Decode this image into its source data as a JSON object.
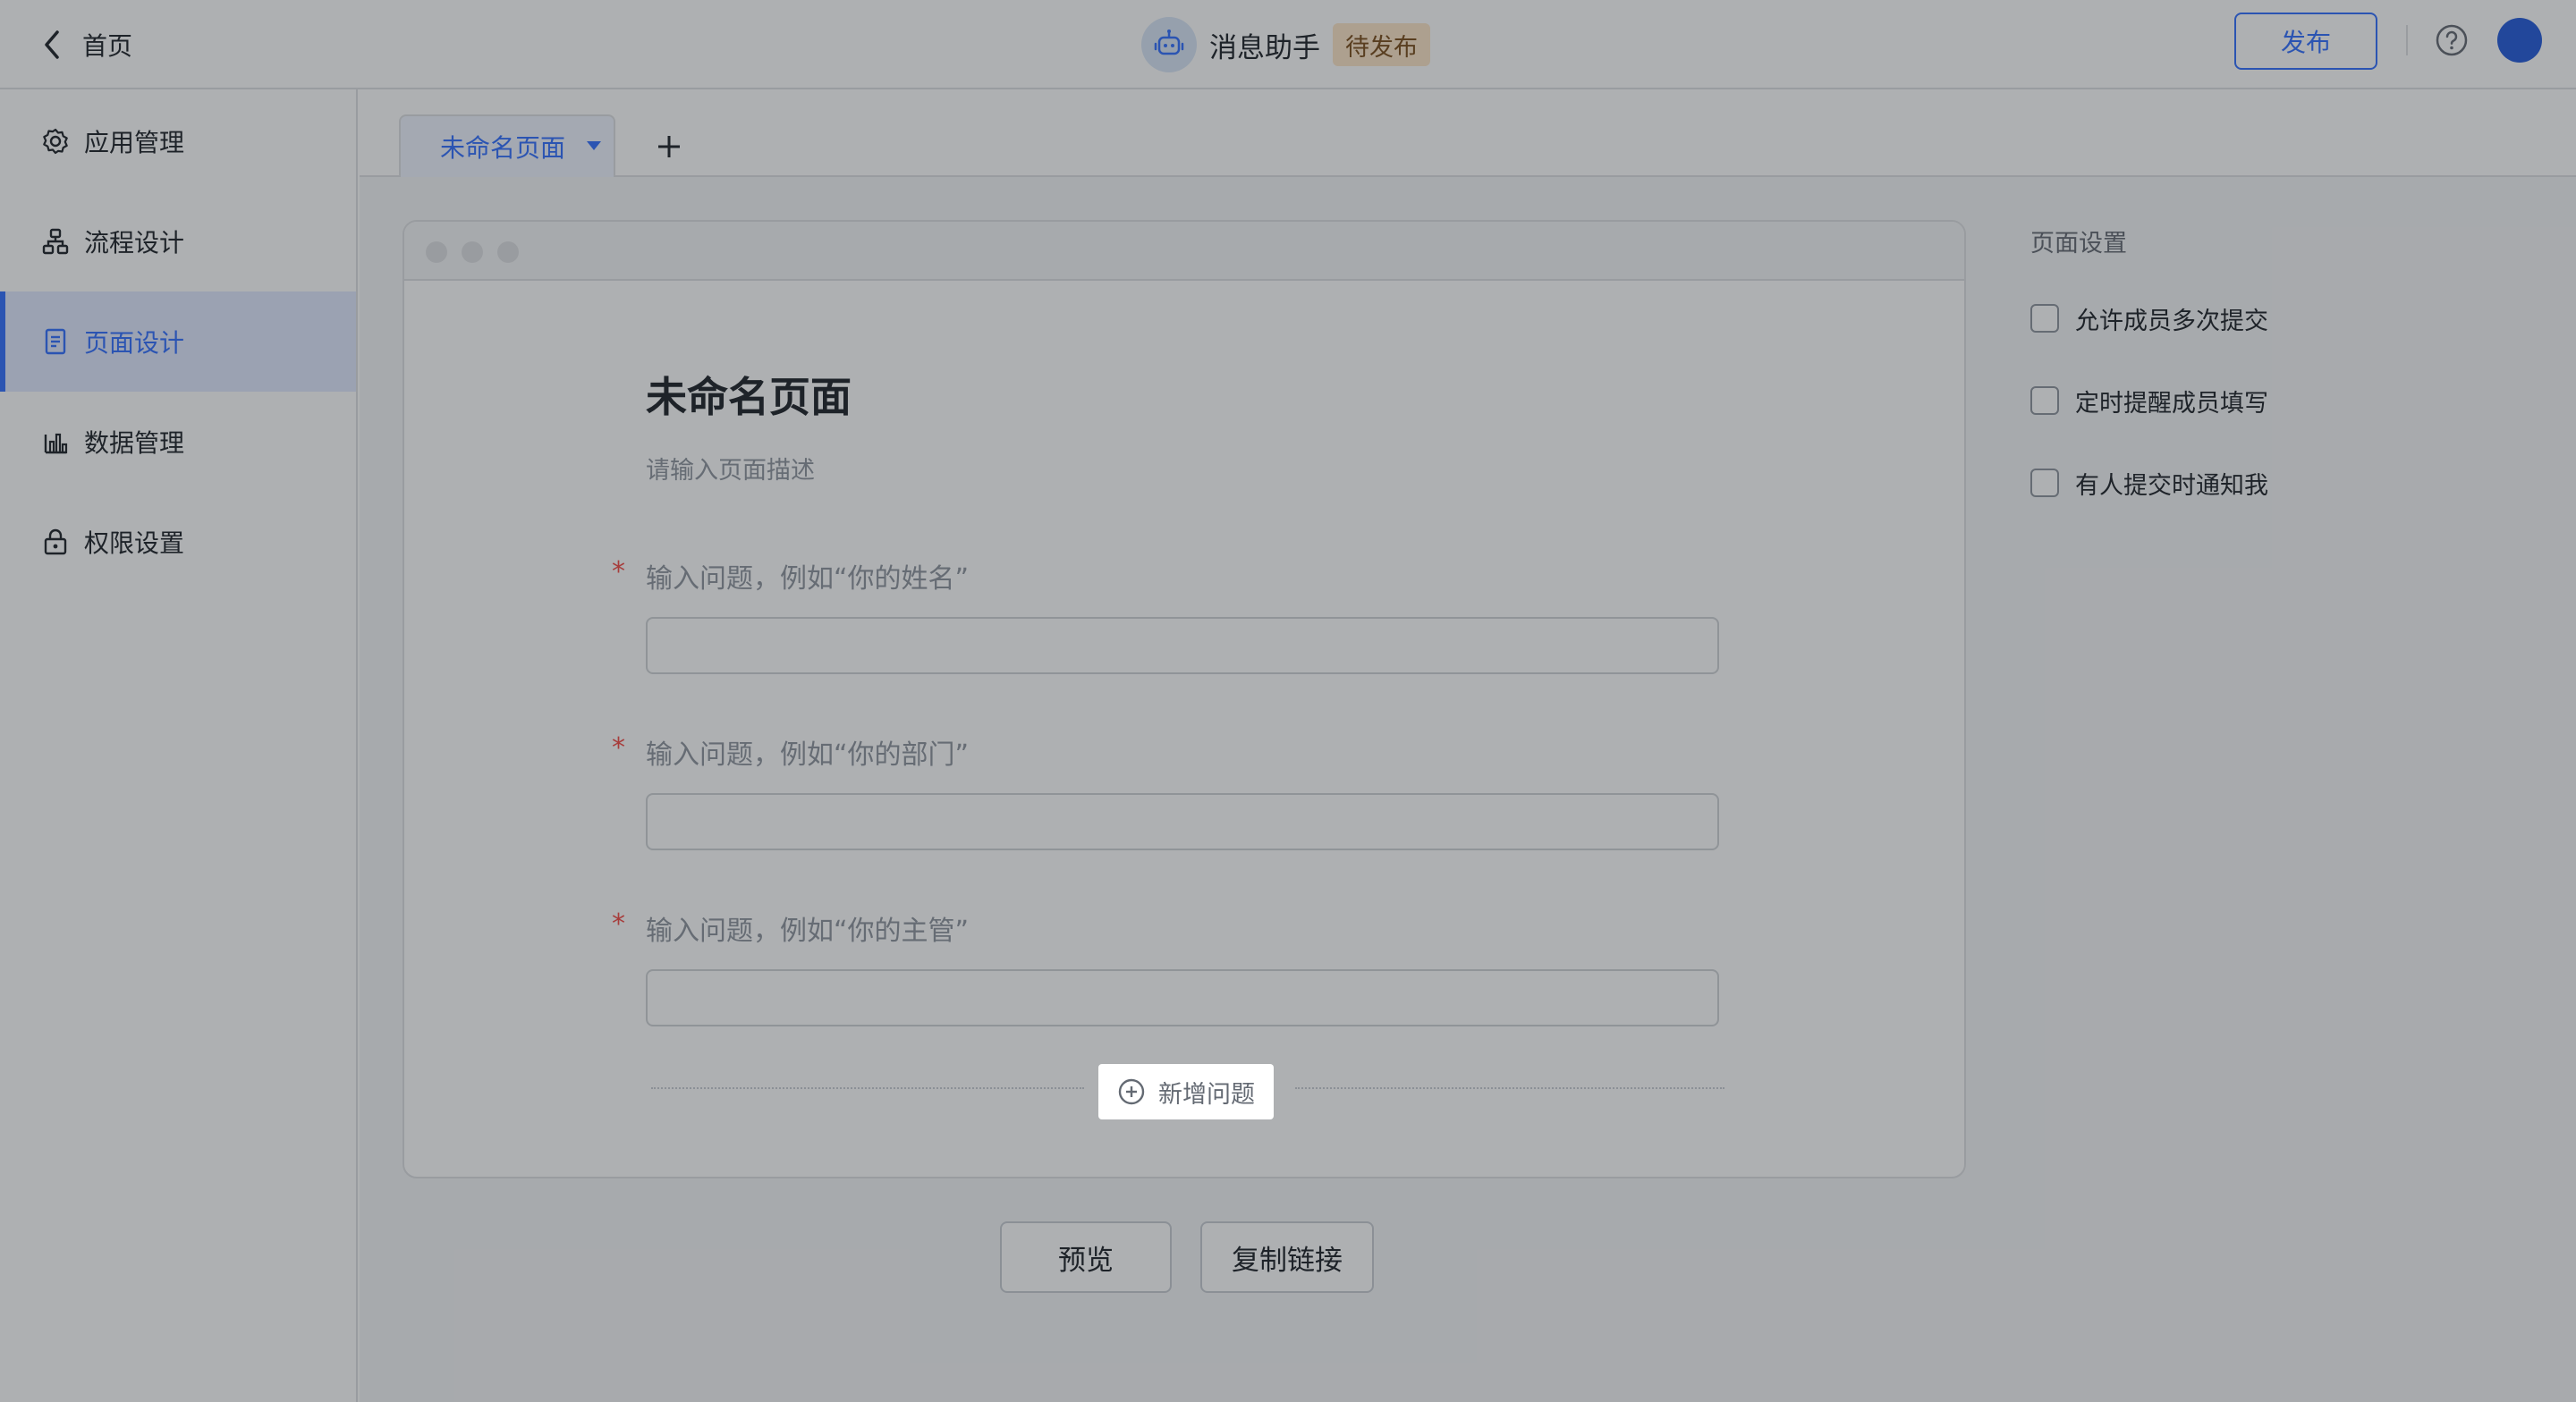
{
  "header": {
    "back_label": "首页",
    "app_title": "消息助手",
    "status_badge": "待发布",
    "publish_label": "发布"
  },
  "sidebar": {
    "items": [
      {
        "label": "应用管理",
        "icon": "gear-icon"
      },
      {
        "label": "流程设计",
        "icon": "flow-icon"
      },
      {
        "label": "页面设计",
        "icon": "page-icon",
        "active": true
      },
      {
        "label": "数据管理",
        "icon": "bar-chart-icon"
      },
      {
        "label": "权限设置",
        "icon": "lock-icon"
      }
    ]
  },
  "tabs": {
    "active_tab": "未命名页面"
  },
  "form": {
    "title": "未命名页面",
    "description_placeholder": "请输入页面描述",
    "questions": [
      {
        "label": "输入问题，例如“你的姓名”",
        "required_mark": "*"
      },
      {
        "label": "输入问题，例如“你的部门”",
        "required_mark": "*"
      },
      {
        "label": "输入问题，例如“你的主管”",
        "required_mark": "*"
      }
    ],
    "add_question_label": "新增问题"
  },
  "settings": {
    "title": "页面设置",
    "options": [
      {
        "label": "允许成员多次提交",
        "checked": false
      },
      {
        "label": "定时提醒成员填写",
        "checked": false
      },
      {
        "label": "有人提交时通知我",
        "checked": false
      }
    ]
  },
  "actions": {
    "preview_label": "预览",
    "copy_link_label": "复制链接"
  },
  "colors": {
    "accent": "#3370ff",
    "required": "#f54a45",
    "badge_bg": "#fde6c8",
    "overlay": "rgba(31,35,41,0.36)"
  }
}
